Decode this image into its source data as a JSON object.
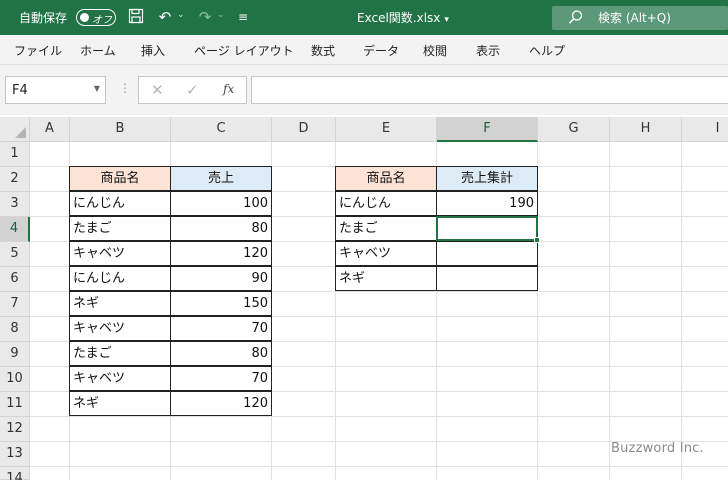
{
  "titlebar": {
    "autosave_label": "自動保存",
    "autosave_state": "オフ",
    "filename": "Excel関数.xlsx",
    "search_placeholder": "検索 (Alt+Q)"
  },
  "menu": [
    "ファイル",
    "ホーム",
    "挿入",
    "ページ レイアウト",
    "数式",
    "データ",
    "校閲",
    "表示",
    "ヘルプ"
  ],
  "formula_bar": {
    "name_box": "F4",
    "fx_label": "fx",
    "formula": ""
  },
  "grid": {
    "columns": [
      "A",
      "B",
      "C",
      "D",
      "E",
      "F",
      "G",
      "H",
      "I"
    ],
    "rows": [
      "1",
      "2",
      "3",
      "4",
      "5",
      "6",
      "7",
      "8",
      "9",
      "10",
      "11",
      "12",
      "13",
      "14"
    ],
    "active_cell": "F4"
  },
  "table1": {
    "header_product": "商品名",
    "header_sales": "売上",
    "rows": [
      {
        "product": "にんじん",
        "sales": "100"
      },
      {
        "product": "たまご",
        "sales": "80"
      },
      {
        "product": "キャベツ",
        "sales": "120"
      },
      {
        "product": "にんじん",
        "sales": "90"
      },
      {
        "product": "ネギ",
        "sales": "150"
      },
      {
        "product": "キャベツ",
        "sales": "70"
      },
      {
        "product": "たまご",
        "sales": "80"
      },
      {
        "product": "キャベツ",
        "sales": "70"
      },
      {
        "product": "ネギ",
        "sales": "120"
      }
    ]
  },
  "table2": {
    "header_product": "商品名",
    "header_total": "売上集計",
    "rows": [
      {
        "product": "にんじん",
        "total": "190"
      },
      {
        "product": "たまご",
        "total": ""
      },
      {
        "product": "キャベツ",
        "total": ""
      },
      {
        "product": "ネギ",
        "total": ""
      }
    ]
  },
  "watermark": "Buzzword Inc.",
  "colors": {
    "excel_green": "#217346",
    "header_peach": "#fbe4d5",
    "header_blue": "#ddebf7"
  }
}
